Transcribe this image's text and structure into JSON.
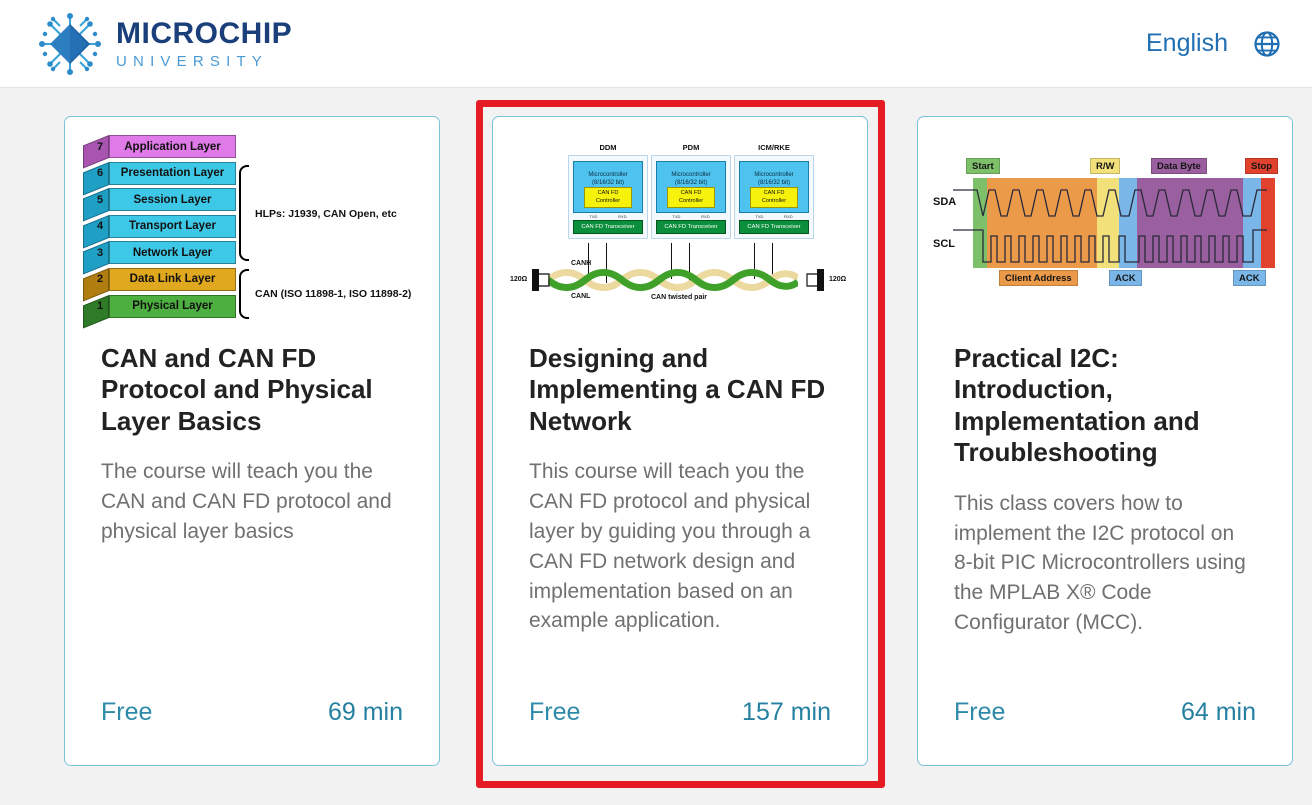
{
  "header": {
    "brand_main": "MICROCHIP",
    "brand_sub": "UNIVERSITY",
    "logo_icon": "microchip-diamond-logo",
    "language_label": "English",
    "globe_icon": "globe-icon"
  },
  "cards": [
    {
      "title": "CAN and CAN FD Protocol and Physical Layer Basics",
      "description": "The course will teach you the CAN and CAN FD protocol and physical layer basics",
      "price": "Free",
      "duration": "69 min",
      "highlighted": false,
      "thumbnail": {
        "type": "osi-layer-stack",
        "layers": [
          {
            "num": "7",
            "label": "Application Layer",
            "color": "#e07ae8"
          },
          {
            "num": "6",
            "label": "Presentation Layer",
            "color": "#3ec8e8"
          },
          {
            "num": "5",
            "label": "Session Layer",
            "color": "#3ec8e8"
          },
          {
            "num": "4",
            "label": "Transport Layer",
            "color": "#3ec8e8"
          },
          {
            "num": "3",
            "label": "Network Layer",
            "color": "#3ec8e8"
          },
          {
            "num": "2",
            "label": "Data Link Layer",
            "color": "#e0a81e"
          },
          {
            "num": "1",
            "label": "Physical Layer",
            "color": "#4caf3f"
          }
        ],
        "annotations": [
          "HLPs: J1939, CAN Open, etc",
          "CAN (ISO 11898-1, ISO 11898-2)"
        ]
      }
    },
    {
      "title": "Designing and Implementing a CAN FD Network",
      "description": "This course will teach you the CAN FD protocol and physical layer by guiding you through a CAN FD network design and implementation based on an example application.",
      "price": "Free",
      "duration": "157 min",
      "highlighted": true,
      "highlight_color": "#e51c23",
      "thumbnail": {
        "type": "can-fd-network",
        "nodes": [
          {
            "name": "DDM",
            "mcu": "Microcontroller",
            "mcu_sub": "(8/16/32 bit)",
            "controller": "CAN FD Controller",
            "transceiver": "CAN FD Transceiver"
          },
          {
            "name": "PDM",
            "mcu": "Microcontroller",
            "mcu_sub": "(8/16/32 bit)",
            "controller": "CAN FD Controller",
            "transceiver": "CAN FD Transceiver"
          },
          {
            "name": "ICM/RKE",
            "mcu": "Microcontroller",
            "mcu_sub": "(8/16/32 bit)",
            "controller": "CAN FD Controller",
            "transceiver": "CAN FD Transceiver"
          }
        ],
        "bus_labels": {
          "high": "CANH",
          "low": "CANL",
          "bus": "CAN twisted pair",
          "term_left": "120Ω",
          "term_right": "120Ω"
        }
      }
    },
    {
      "title": "Practical I2C: Introduction, Implementation and Troubleshooting",
      "description": "This class covers how to implement the I2C protocol on 8-bit PIC Microcontrollers using the MPLAB X® Code Configurator (MCC).",
      "price": "Free",
      "duration": "64 min",
      "highlighted": false,
      "thumbnail": {
        "type": "i2c-timing-diagram",
        "signals": [
          "SDA",
          "SCL"
        ],
        "phases": [
          {
            "label": "Start",
            "color": "#7ebf6a",
            "position": "top"
          },
          {
            "label": "Client Address",
            "color": "#eb9a4a",
            "position": "bottom"
          },
          {
            "label": "R/W",
            "color": "#f2e07a",
            "position": "top"
          },
          {
            "label": "ACK",
            "color": "#7ab6e8",
            "position": "bottom"
          },
          {
            "label": "Data Byte",
            "color": "#9a5f9e",
            "position": "top"
          },
          {
            "label": "ACK",
            "color": "#7ab6e8",
            "position": "bottom"
          },
          {
            "label": "Stop",
            "color": "#e0422e",
            "position": "top"
          }
        ]
      }
    }
  ]
}
